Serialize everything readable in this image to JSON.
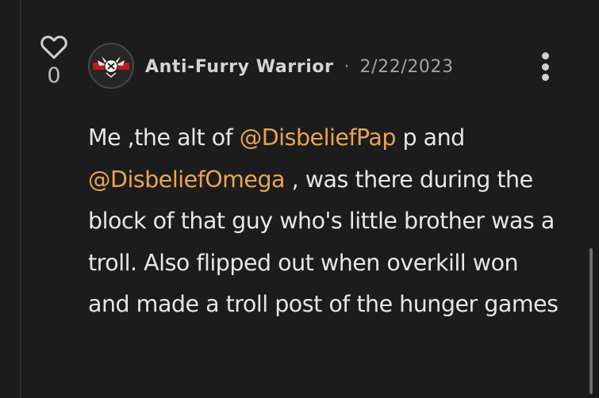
{
  "post": {
    "likes": "0",
    "author": "Anti-Furry Warrior",
    "separator": "·",
    "date": "2/22/2023",
    "body": {
      "part1": "Me ,the alt of ",
      "mention1": "@DisbeliefPap",
      "part2": " p and ",
      "mention2": "@DisbeliefOmega",
      "part3": " , was there during the block of that guy who's little brother was a troll. Also flipped out when overkill won and made a troll post of the hunger games"
    }
  },
  "icons": {
    "like": "heart-outline-icon",
    "menu": "vertical-ellipsis-icon",
    "avatar": "avatar-emblem"
  },
  "colors": {
    "background": "#1c1c1c",
    "text": "#e6e6e6",
    "mention": "#e8a451",
    "muted": "#a3a3a3"
  }
}
